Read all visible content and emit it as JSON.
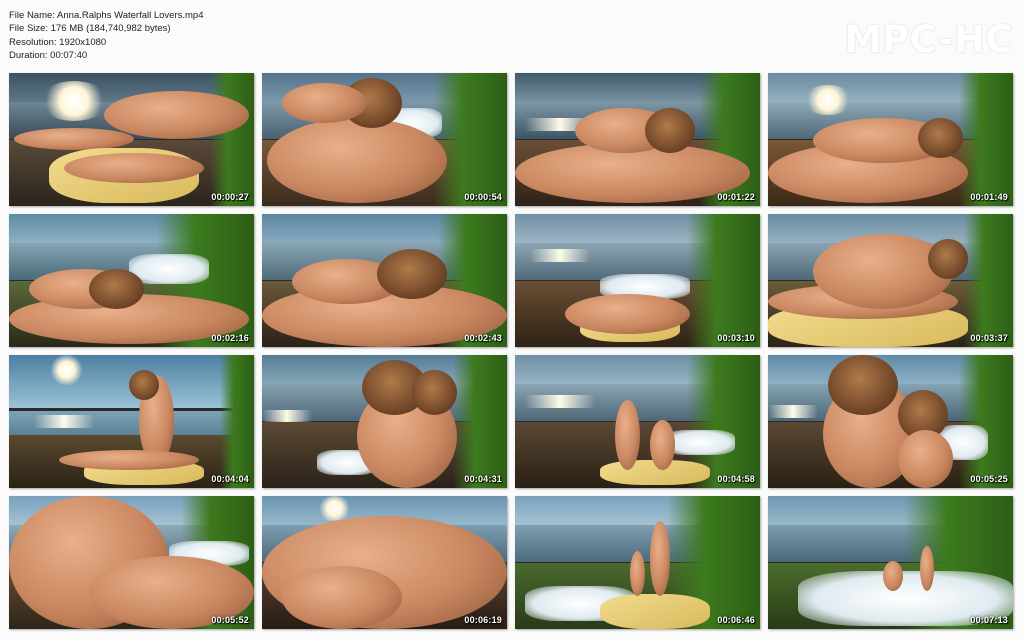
{
  "info": {
    "file_name": "File Name: Anna.Ralphs Waterfall Lovers.mp4",
    "file_size": "File Size: 176 MB (184,740,982 bytes)",
    "resolution": "Resolution: 1920x1080",
    "duration": "Duration: 00:07:40"
  },
  "logo": "MPC-HC",
  "thumbnails": [
    {
      "timestamp": "00:00:27"
    },
    {
      "timestamp": "00:00:54"
    },
    {
      "timestamp": "00:01:22"
    },
    {
      "timestamp": "00:01:49"
    },
    {
      "timestamp": "00:02:16"
    },
    {
      "timestamp": "00:02:43"
    },
    {
      "timestamp": "00:03:10"
    },
    {
      "timestamp": "00:03:37"
    },
    {
      "timestamp": "00:04:04"
    },
    {
      "timestamp": "00:04:31"
    },
    {
      "timestamp": "00:04:58"
    },
    {
      "timestamp": "00:05:25"
    },
    {
      "timestamp": "00:05:52"
    },
    {
      "timestamp": "00:06:19"
    },
    {
      "timestamp": "00:06:46"
    },
    {
      "timestamp": "00:07:13"
    }
  ]
}
